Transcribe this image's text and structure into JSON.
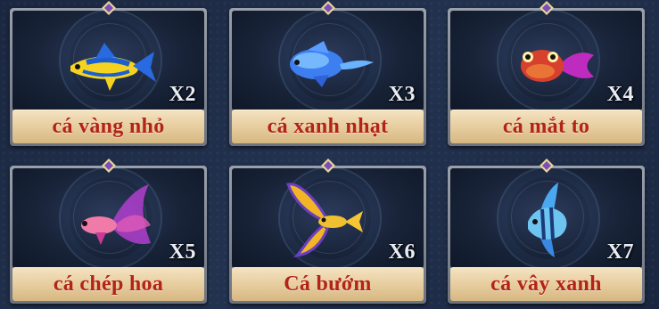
{
  "items": [
    {
      "name": "cá vàng nhỏ",
      "multiplier": "X2",
      "icon": "yellow-fish-icon"
    },
    {
      "name": "cá xanh nhạt",
      "multiplier": "X3",
      "icon": "light-blue-fish-icon"
    },
    {
      "name": "cá mắt to",
      "multiplier": "X4",
      "icon": "big-eye-fish-icon"
    },
    {
      "name": "cá chép hoa",
      "multiplier": "X5",
      "icon": "flower-carp-icon"
    },
    {
      "name": "Cá bướm",
      "multiplier": "X6",
      "icon": "butterfly-fish-icon"
    },
    {
      "name": "cá vây xanh",
      "multiplier": "X7",
      "icon": "blue-fin-fish-icon"
    }
  ],
  "colors": {
    "label_text": "#b32316",
    "label_bg": "#e7cd9f",
    "card_bg": "#182338",
    "background": "#1d2b45"
  }
}
